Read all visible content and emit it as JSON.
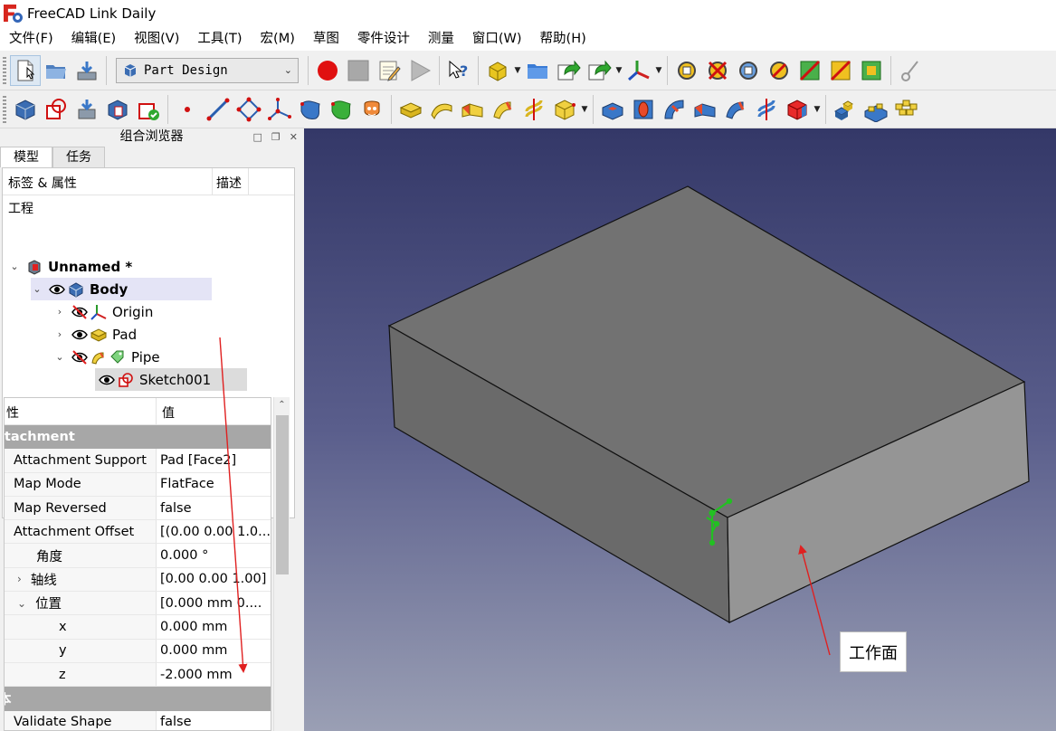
{
  "window": {
    "title": "FreeCAD Link Daily"
  },
  "menu": [
    "文件(F)",
    "编辑(E)",
    "视图(V)",
    "工具(T)",
    "宏(M)",
    "草图",
    "零件设计",
    "测量",
    "窗口(W)",
    "帮助(H)"
  ],
  "toolbar": {
    "workbench": "Part Design"
  },
  "combo_view": {
    "title": "组合浏览器",
    "tabs": [
      "模型",
      "任务"
    ],
    "tree_header": {
      "label_col": "标签 & 属性",
      "desc_col": "描述"
    },
    "root_label": "工程",
    "nodes": {
      "document": "Unnamed *",
      "body": "Body",
      "origin": "Origin",
      "pad": "Pad",
      "pipe": "Pipe",
      "sketch": "Sketch001"
    }
  },
  "properties": {
    "header": {
      "name_col": "性",
      "value_col": "值"
    },
    "groups": {
      "attachment": "ttachment",
      "basic": "本"
    },
    "rows": [
      {
        "name": "Attachment Support",
        "value": "Pad [Face2]"
      },
      {
        "name": "Map Mode",
        "value": "FlatFace"
      },
      {
        "name": "Map Reversed",
        "value": "false"
      },
      {
        "name": "Attachment Offset",
        "value": "[(0.00 0.00 1.0..."
      },
      {
        "name": "角度",
        "value": "0.000 °"
      },
      {
        "name": "轴线",
        "value": "[0.00 0.00 1.00]"
      },
      {
        "name": "位置",
        "value": "[0.000 mm  0...."
      },
      {
        "name": "x",
        "value": "0.000 mm"
      },
      {
        "name": "y",
        "value": "0.000 mm"
      },
      {
        "name": "z",
        "value": "-2.000 mm"
      }
    ],
    "last_row": {
      "name": "Validate Shape",
      "value": "false"
    }
  },
  "viewport": {
    "annotation": "工作面"
  },
  "colors": {
    "annotation_arrow": "#e02020",
    "sketch_axes": "#22c022",
    "group_header": "#a7a7a7",
    "body_highlight": "#e4e4f6"
  }
}
